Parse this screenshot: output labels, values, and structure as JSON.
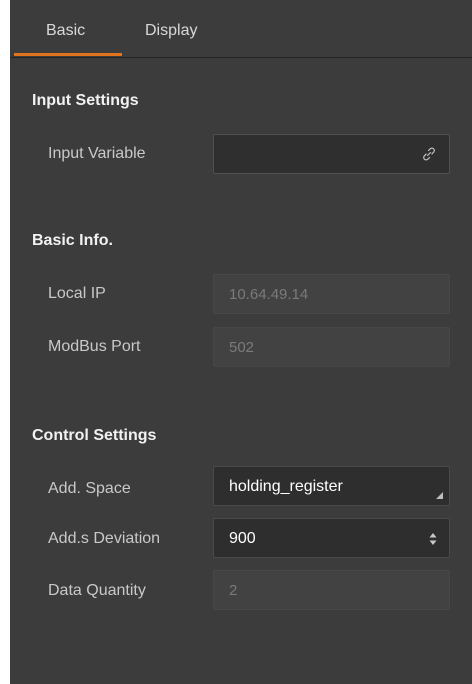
{
  "tabs": [
    {
      "label": "Basic",
      "active": true
    },
    {
      "label": "Display",
      "active": false
    }
  ],
  "accent_color": "#e0731d",
  "sections": {
    "input": {
      "title": "Input Settings",
      "input_variable_label": "Input Variable",
      "input_variable_value": "",
      "link_icon": "link-icon"
    },
    "basic_info": {
      "title": "Basic Info.",
      "local_ip_label": "Local IP",
      "local_ip_value": "10.64.49.14",
      "modbus_port_label": "ModBus Port",
      "modbus_port_value": "502"
    },
    "control": {
      "title": "Control Settings",
      "add_space_label": "Add. Space",
      "add_space_value": "holding_register",
      "add_deviation_label": "Add.s Deviation",
      "add_deviation_value": "900",
      "data_quantity_label": "Data Quantity",
      "data_quantity_value": "2"
    }
  }
}
